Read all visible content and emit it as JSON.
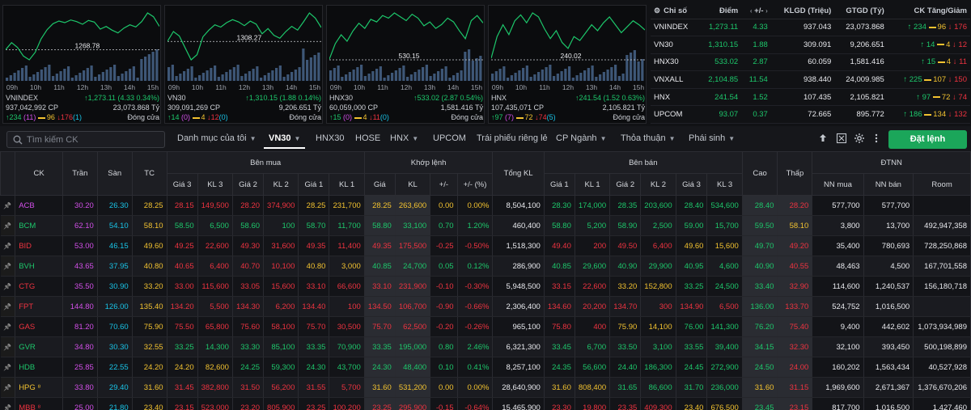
{
  "charts": [
    {
      "name": "VNINDEX",
      "ref": "1268.78",
      "line_color": "#1dc76b",
      "volume": "937,042,992 CP",
      "value": "23,073.868 Tỷ",
      "change": "1,273.11 (4.33 0.34%)",
      "up": "234",
      "ref_count": "(11)",
      "flat": "96",
      "down": "176",
      "ceil_down": "(1)",
      "status": "Đóng cửa",
      "series": [
        1268.8,
        1270.1,
        1269.2,
        1267.6,
        1266.9,
        1268.3,
        1270.8,
        1272.5,
        1273.6,
        1274.1,
        1273.8,
        1274.3,
        1274.0,
        1273.5,
        1274.2,
        1273.9,
        1272.6,
        1273.1,
        1272.4,
        1271.9,
        1272.8,
        1273.4,
        1273.0,
        1274.0,
        1275.6,
        1274.9,
        1273.11
      ]
    },
    {
      "name": "VN30",
      "ref": "1308.27",
      "line_color": "#1dc76b",
      "volume": "309,091,269 CP",
      "value": "9,206.651 Tỷ",
      "change": "1,310.15 (1.88 0.14%)",
      "up": "14",
      "ref_count": "(0)",
      "flat": "4",
      "down": "12",
      "ceil_down": "(0)",
      "status": "Đóng cửa",
      "series": [
        1308.3,
        1309.6,
        1309.0,
        1307.4,
        1305.8,
        1306.5,
        1308.9,
        1309.8,
        1310.5,
        1310.2,
        1310.8,
        1311.2,
        1310.9,
        1310.4,
        1311.0,
        1310.6,
        1309.3,
        1310.0,
        1309.1,
        1308.7,
        1309.6,
        1310.3,
        1309.8,
        1310.9,
        1312.1,
        1311.4,
        1310.15
      ]
    },
    {
      "name": "HNX30",
      "ref": "530.15",
      "line_color": "#1dc76b",
      "volume": "60,059,000 CP",
      "value": "1,581.416 Tỷ",
      "change": "533.02 (2.87 0.54%)",
      "up": "15",
      "ref_count": "(0)",
      "flat": "4",
      "down": "11",
      "ceil_down": "(0)",
      "status": "Đóng cửa",
      "series": [
        530.2,
        531.4,
        532.1,
        531.6,
        532.4,
        533.0,
        532.6,
        533.3,
        533.1,
        533.6,
        533.4,
        533.8,
        533.5,
        533.2,
        533.7,
        533.4,
        532.8,
        533.1,
        532.6,
        532.9,
        533.4,
        533.1,
        532.4,
        531.8,
        533.2,
        533.6,
        533.02
      ]
    },
    {
      "name": "HNX",
      "ref": "240.02",
      "line_color": "#1dc76b",
      "volume": "107,435,071 CP",
      "value": "2,105.821 Tỷ",
      "change": "241.54 (1.52 0.63%)",
      "up": "97",
      "ref_count": "(7)",
      "flat": "72",
      "down": "74",
      "ceil_down": "(5)",
      "status": "Đóng cửa",
      "series": [
        240.1,
        241.2,
        241.8,
        241.3,
        242.0,
        242.3,
        241.9,
        242.4,
        242.2,
        241.6,
        241.1,
        241.5,
        240.9,
        240.6,
        241.2,
        241.0,
        241.4,
        241.8,
        241.5,
        241.9,
        242.2,
        241.8,
        241.4,
        241.7,
        242.0,
        241.8,
        241.54
      ]
    }
  ],
  "times": [
    "09h",
    "10h",
    "11h",
    "12h",
    "13h",
    "14h",
    "15h"
  ],
  "summary": {
    "headers": [
      "Chỉ số",
      "Điểm",
      "+/-",
      "KLGD (Triệu)",
      "GTGD (Tỷ)",
      "CK Tăng/Giảm"
    ],
    "rows": [
      {
        "name": "VNINDEX",
        "point": "1,273.11",
        "change": "4.33",
        "vol": "937.043",
        "value": "23,073.868",
        "up": "234",
        "flat": "96",
        "down": "176"
      },
      {
        "name": "VN30",
        "point": "1,310.15",
        "change": "1.88",
        "vol": "309.091",
        "value": "9,206.651",
        "up": "14",
        "flat": "4",
        "down": "12"
      },
      {
        "name": "HNX30",
        "point": "533.02",
        "change": "2.87",
        "vol": "60.059",
        "value": "1,581.416",
        "up": "15",
        "flat": "4",
        "down": "11"
      },
      {
        "name": "VNXALL",
        "point": "2,104.85",
        "change": "11.54",
        "vol": "938.440",
        "value": "24,009.985",
        "up": "225",
        "flat": "107",
        "down": "150"
      },
      {
        "name": "HNX",
        "point": "241.54",
        "change": "1.52",
        "vol": "107.435",
        "value": "2,105.821",
        "up": "97",
        "flat": "72",
        "down": "74"
      },
      {
        "name": "UPCOM",
        "point": "93.07",
        "change": "0.37",
        "vol": "72.665",
        "value": "895.772",
        "up": "186",
        "flat": "134",
        "down": "132"
      }
    ]
  },
  "toolbar": {
    "search_placeholder": "Tìm kiếm CK",
    "tabs": [
      "Danh mục của tôi",
      "VN30",
      "HNX30",
      "HOSE",
      "HNX",
      "UPCOM",
      "Trái phiếu riêng lẻ",
      "CP Ngành",
      "Thỏa thuận",
      "Phái sinh"
    ],
    "order_button": "Đặt lệnh"
  },
  "board": {
    "group_headers": {
      "buy": "Bên mua",
      "match": "Khớp lệnh",
      "sell": "Bên bán",
      "foreign": "ĐTNN"
    },
    "col_headers": {
      "ck": "CK",
      "ceil": "Trần",
      "floor": "Sàn",
      "ref": "TC",
      "g3": "Giá 3",
      "k3": "KL 3",
      "g2": "Giá 2",
      "k2": "KL 2",
      "g1": "Giá 1",
      "k1": "KL 1",
      "mp": "Giá",
      "mk": "KL",
      "mc": "+/-",
      "mpct": "+/- (%)",
      "total": "Tổng KL",
      "cao": "Cao",
      "thap": "Thấp",
      "nnmua": "NN mua",
      "nnban": "NN bán",
      "room": "Room"
    },
    "rows": [
      {
        "ck": "ACB",
        "c": "p",
        "ceil": "30.20",
        "floor": "26.30",
        "ref": "28.25",
        "b3": [
          "28.15",
          "149,500",
          "r"
        ],
        "b2": [
          "28.20",
          "374,900",
          "r"
        ],
        "b1": [
          "28.25",
          "231,700",
          "y"
        ],
        "m": [
          "28.25",
          "263,600",
          "0.00",
          "0.00%",
          "y"
        ],
        "total": "8,504,100",
        "s1": [
          "28.30",
          "174,000",
          "g"
        ],
        "s2": [
          "28.35",
          "203,600",
          "g"
        ],
        "s3": [
          "28.40",
          "534,600",
          "g"
        ],
        "hi": [
          "28.40",
          "g"
        ],
        "lo": [
          "28.20",
          "r"
        ],
        "nnm": "577,700",
        "nnb": "577,700",
        "room": ""
      },
      {
        "ck": "BCM",
        "c": "g",
        "ceil": "62.10",
        "floor": "54.10",
        "ref": "58.10",
        "b3": [
          "58.50",
          "6,500",
          "g"
        ],
        "b2": [
          "58.60",
          "100",
          "g"
        ],
        "b1": [
          "58.70",
          "11,700",
          "g"
        ],
        "m": [
          "58.80",
          "33,100",
          "0.70",
          "1.20%",
          "g"
        ],
        "total": "460,400",
        "s1": [
          "58.80",
          "5,200",
          "g"
        ],
        "s2": [
          "58.90",
          "2,500",
          "g"
        ],
        "s3": [
          "59.00",
          "15,700",
          "g"
        ],
        "hi": [
          "59.50",
          "g"
        ],
        "lo": [
          "58.10",
          "y"
        ],
        "nnm": "3,800",
        "nnb": "13,700",
        "room": "492,947,358"
      },
      {
        "ck": "BID",
        "c": "r",
        "ceil": "53.00",
        "floor": "46.15",
        "ref": "49.60",
        "b3": [
          "49.25",
          "22,600",
          "r"
        ],
        "b2": [
          "49.30",
          "31,600",
          "r"
        ],
        "b1": [
          "49.35",
          "11,400",
          "r"
        ],
        "m": [
          "49.35",
          "175,500",
          "-0.25",
          "-0.50%",
          "r"
        ],
        "total": "1,518,300",
        "s1": [
          "49.40",
          "200",
          "r"
        ],
        "s2": [
          "49.50",
          "6,400",
          "r"
        ],
        "s3": [
          "49.60",
          "15,600",
          "y"
        ],
        "hi": [
          "49.70",
          "g"
        ],
        "lo": [
          "49.20",
          "r"
        ],
        "nnm": "35,400",
        "nnb": "780,693",
        "room": "728,250,868"
      },
      {
        "ck": "BVH",
        "c": "g",
        "ceil": "43.65",
        "floor": "37.95",
        "ref": "40.80",
        "b3": [
          "40.65",
          "6,400",
          "r"
        ],
        "b2": [
          "40.70",
          "10,100",
          "r"
        ],
        "b1": [
          "40.80",
          "3,000",
          "y"
        ],
        "m": [
          "40.85",
          "24,700",
          "0.05",
          "0.12%",
          "g"
        ],
        "total": "286,900",
        "s1": [
          "40.85",
          "29,600",
          "g"
        ],
        "s2": [
          "40.90",
          "29,900",
          "g"
        ],
        "s3": [
          "40.95",
          "4,600",
          "g"
        ],
        "hi": [
          "40.90",
          "g"
        ],
        "lo": [
          "40.55",
          "r"
        ],
        "nnm": "48,463",
        "nnb": "4,500",
        "room": "167,701,558"
      },
      {
        "ck": "CTG",
        "c": "r",
        "ceil": "35.50",
        "floor": "30.90",
        "ref": "33.20",
        "b3": [
          "33.00",
          "115,600",
          "r"
        ],
        "b2": [
          "33.05",
          "15,600",
          "r"
        ],
        "b1": [
          "33.10",
          "66,600",
          "r"
        ],
        "m": [
          "33.10",
          "231,900",
          "-0.10",
          "-0.30%",
          "r"
        ],
        "total": "5,948,500",
        "s1": [
          "33.15",
          "22,600",
          "r"
        ],
        "s2": [
          "33.20",
          "152,800",
          "y"
        ],
        "s3": [
          "33.25",
          "24,500",
          "g"
        ],
        "hi": [
          "33.40",
          "g"
        ],
        "lo": [
          "32.90",
          "r"
        ],
        "nnm": "114,600",
        "nnb": "1,240,537",
        "room": "156,180,718"
      },
      {
        "ck": "FPT",
        "c": "r",
        "ceil": "144.80",
        "floor": "126.00",
        "ref": "135.40",
        "b3": [
          "134.20",
          "5,500",
          "r"
        ],
        "b2": [
          "134.30",
          "6,200",
          "r"
        ],
        "b1": [
          "134.40",
          "100",
          "r"
        ],
        "m": [
          "134.50",
          "106,700",
          "-0.90",
          "-0.66%",
          "r"
        ],
        "total": "2,306,400",
        "s1": [
          "134.60",
          "20,200",
          "r"
        ],
        "s2": [
          "134.70",
          "300",
          "r"
        ],
        "s3": [
          "134.90",
          "6,500",
          "r"
        ],
        "hi": [
          "136.00",
          "g"
        ],
        "lo": [
          "133.70",
          "r"
        ],
        "nnm": "524,752",
        "nnb": "1,016,500",
        "room": ""
      },
      {
        "ck": "GAS",
        "c": "r",
        "ceil": "81.20",
        "floor": "70.60",
        "ref": "75.90",
        "b3": [
          "75.50",
          "65,800",
          "r"
        ],
        "b2": [
          "75.60",
          "58,100",
          "r"
        ],
        "b1": [
          "75.70",
          "30,500",
          "r"
        ],
        "m": [
          "75.70",
          "62,500",
          "-0.20",
          "-0.26%",
          "r"
        ],
        "total": "965,100",
        "s1": [
          "75.80",
          "400",
          "r"
        ],
        "s2": [
          "75.90",
          "14,100",
          "y"
        ],
        "s3": [
          "76.00",
          "141,300",
          "g"
        ],
        "hi": [
          "76.20",
          "g"
        ],
        "lo": [
          "75.40",
          "r"
        ],
        "nnm": "9,400",
        "nnb": "442,602",
        "room": "1,073,934,989"
      },
      {
        "ck": "GVR",
        "c": "g",
        "ceil": "34.80",
        "floor": "30.30",
        "ref": "32.55",
        "b3": [
          "33.25",
          "14,300",
          "g"
        ],
        "b2": [
          "33.30",
          "85,100",
          "g"
        ],
        "b1": [
          "33.35",
          "70,900",
          "g"
        ],
        "m": [
          "33.35",
          "195,000",
          "0.80",
          "2.46%",
          "g"
        ],
        "total": "6,321,300",
        "s1": [
          "33.45",
          "6,700",
          "g"
        ],
        "s2": [
          "33.50",
          "3,100",
          "g"
        ],
        "s3": [
          "33.55",
          "39,400",
          "g"
        ],
        "hi": [
          "34.15",
          "g"
        ],
        "lo": [
          "32.30",
          "r"
        ],
        "nnm": "32,100",
        "nnb": "393,450",
        "room": "500,198,899"
      },
      {
        "ck": "HDB",
        "c": "g",
        "ceil": "25.85",
        "floor": "22.55",
        "ref": "24.20",
        "b3": [
          "24.20",
          "82,600",
          "y"
        ],
        "b2": [
          "24.25",
          "59,300",
          "g"
        ],
        "b1": [
          "24.30",
          "43,700",
          "g"
        ],
        "m": [
          "24.30",
          "48,400",
          "0.10",
          "0.41%",
          "g"
        ],
        "total": "8,257,100",
        "s1": [
          "24.35",
          "56,600",
          "g"
        ],
        "s2": [
          "24.40",
          "186,300",
          "g"
        ],
        "s3": [
          "24.45",
          "272,900",
          "g"
        ],
        "hi": [
          "24.50",
          "g"
        ],
        "lo": [
          "24.00",
          "r"
        ],
        "nnm": "160,202",
        "nnb": "1,563,434",
        "room": "40,527,928"
      },
      {
        "ck": "HPG ⁸",
        "c": "y",
        "ceil": "33.80",
        "floor": "29.40",
        "ref": "31.60",
        "b3": [
          "31.45",
          "382,800",
          "r"
        ],
        "b2": [
          "31.50",
          "56,200",
          "r"
        ],
        "b1": [
          "31.55",
          "5,700",
          "r"
        ],
        "m": [
          "31.60",
          "531,200",
          "0.00",
          "0.00%",
          "y"
        ],
        "total": "28,640,900",
        "s1": [
          "31.60",
          "808,400",
          "y"
        ],
        "s2": [
          "31.65",
          "86,600",
          "g"
        ],
        "s3": [
          "31.70",
          "236,000",
          "g"
        ],
        "hi": [
          "31.60",
          "y"
        ],
        "lo": [
          "31.15",
          "r"
        ],
        "nnm": "1,969,600",
        "nnb": "2,671,367",
        "room": "1,376,670,206"
      },
      {
        "ck": "MBB ⁸",
        "c": "r",
        "ceil": "25.00",
        "floor": "21.80",
        "ref": "23.40",
        "b3": [
          "23.15",
          "523,000",
          "r"
        ],
        "b2": [
          "23.20",
          "805,900",
          "r"
        ],
        "b1": [
          "23.25",
          "100,200",
          "r"
        ],
        "m": [
          "23.25",
          "295,900",
          "-0.15",
          "-0.64%",
          "r"
        ],
        "total": "15,465,900",
        "s1": [
          "23.30",
          "19,800",
          "r"
        ],
        "s2": [
          "23.35",
          "409,300",
          "r"
        ],
        "s3": [
          "23.40",
          "676,500",
          "y"
        ],
        "hi": [
          "23.45",
          "g"
        ],
        "lo": [
          "23.15",
          "r"
        ],
        "nnm": "817,700",
        "nnb": "1,016,500",
        "room": "1,427,460"
      }
    ]
  },
  "colors": {
    "up": "#1dc76b",
    "down": "#ee3340",
    "ref": "#f2c230",
    "ceil": "#d24fe8",
    "floor": "#19c3e6",
    "accent": "#1ba65a"
  },
  "icons": {
    "search": "search-icon",
    "settings": "gear-icon",
    "pin": "pin-icon"
  }
}
